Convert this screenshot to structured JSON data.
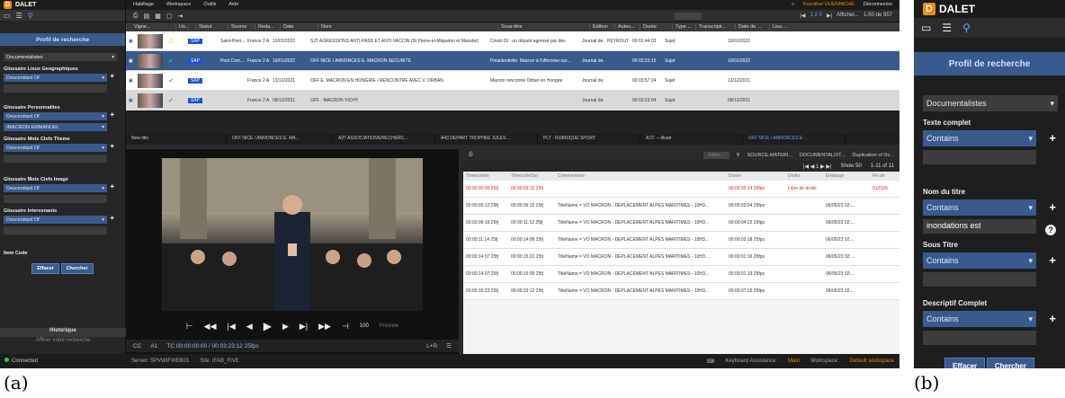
{
  "captions": {
    "a": "(a)",
    "b": "(b)"
  },
  "brand": {
    "logo_letter": "D",
    "name": "DALET"
  },
  "menu": {
    "items": [
      "Habillage",
      "Workspace",
      "Outils",
      "Aide"
    ],
    "user": "Kaouther OUENNICHE",
    "logout": "Déconnexion"
  },
  "search_panel": {
    "title": "Profil de recherche",
    "profile": "Documentalistes",
    "fields": [
      {
        "label": "Glossaire Lieux Geographiques",
        "op": "Descendant Of",
        "value": ""
      },
      {
        "label": "Glossaire Personnalites",
        "op": "Descendant Of",
        "value": "/MACRON EMMANUEL"
      },
      {
        "label": "Glossaire Mots Clefs Theme",
        "op": "Descendant Of",
        "value": ""
      },
      {
        "label": "Glossaire Mots Clefs Image",
        "op": "Descendant Of",
        "value": ""
      },
      {
        "label": "Glossaire Intervenants",
        "op": "Descendant Of",
        "value": ""
      }
    ],
    "item_code": "Item Code",
    "clear": "Effacer",
    "search": "Chercher",
    "history": "Historique",
    "refine": "Affiner votre recherche",
    "connected": "Connected"
  },
  "results": {
    "search_placeholder": "Filtre...",
    "pager": "1 2 3",
    "display": "Afficher...",
    "count": "1-50 de 957",
    "columns": [
      "Vigne...",
      "Us...",
      "Statut",
      "Source",
      "Reda...",
      "Date",
      "Nom",
      "Sous-titre",
      "Edition",
      "Auteu...",
      "Durée",
      "Type ...",
      "Transcripti...",
      "Date de ...",
      "Lieu ..."
    ],
    "rows": [
      {
        "status": "SAP",
        "source": "Saint-Pierr...",
        "reda": "France 2 A...",
        "date": "10/01/2022",
        "nom": "SJT AGRESSIONS ANTI-PASS ET ANTI-VACCIN (St Pierre-et-Miquelon et Manster)",
        "sous": "Covid-19 : un député agressé par des",
        "edition": "Journal de...",
        "auteur": "PEYROUT ...",
        "duree": "00:01:44:03",
        "type": "Sujet",
        "dated": "10/01/2022"
      },
      {
        "status": "SAP",
        "source": "Pool Com...",
        "reda": "France 2 A...",
        "date": "10/01/2022",
        "nom": "OFF NICE / ANNONCES E. MACRON SÉCURITÉ",
        "sous": "Présidentielle: Macron à l'offensive sur...",
        "edition": "Journal de...",
        "auteur": "",
        "duree": "00:03:23:15",
        "type": "Sujet",
        "dated": "10/01/2022"
      },
      {
        "status": "SAP",
        "source": "",
        "reda": "France 2 A...",
        "date": "13/12/2021",
        "nom": "OFF E. MACRON EN HONGRIE / RENCONTRE AVEC V. ORBAN",
        "sous": "Macron rencontre Orban en Hongrie",
        "edition": "Journal de...",
        "auteur": "",
        "duree": "00:03:57:24",
        "type": "Sujet",
        "dated": "13/12/2021"
      },
      {
        "status": "SAP",
        "source": "",
        "reda": "France 2 A...",
        "date": "08/12/2021",
        "nom": "OFF - MACRON VICHY",
        "sous": "",
        "edition": "Journal de...",
        "auteur": "",
        "duree": "00:03:23:04",
        "type": "Sujet",
        "dated": "08/12/2021"
      }
    ]
  },
  "tabs": [
    "New title",
    "OFF NICE / ANNONCES E. MA...",
    "A37 ASSOCIATIONS/RECHERC...",
    "A43 DEPART TROPHEE JULES ...",
    "PLT - RUBRIQUE SPORT",
    "A72 ----illustr",
    "OFF NICE / ANNONCES E. ..."
  ],
  "player": {
    "cc": "CC",
    "track": "A1",
    "timecode": "TC 00:00:00:00 / 00:03:23:12 25fps",
    "volume": "100",
    "preview": "Preview",
    "lr": "L+R"
  },
  "segments": {
    "filter": "Filtre...",
    "source": "SOURCE-MATERI...",
    "doc": "DOCUMENTALIST...",
    "dup": "Duplication of Do...",
    "show": "Show 50",
    "count": "1-11 of 11",
    "columns": [
      "TimecodeIn",
      "TimecodeOut",
      "Commentaire",
      "Durée",
      "Droits",
      "Embargo",
      "Fin de"
    ],
    "rows": [
      {
        "in": "00:00:00:00 25fj",
        "out": "00:00:03:12 25fj",
        "com": "",
        "dur": "00:00:03:14 25fps",
        "droits": "Libre de droits",
        "emb": "",
        "fin": "01/01/9"
      },
      {
        "in": "00:00:03:12 25fj",
        "out": "00:00:06:15 25fj",
        "com": "TitleName = VO MACRON - DEPLACEMENT ALPES MARITIMES - 10H3...",
        "dur": "00:00:03:04 25fps",
        "droits": "",
        "emb": "06/05/23 02:...",
        "fin": ""
      },
      {
        "in": "00:00:06:16 25fj",
        "out": "00:00:11:12 25fj",
        "com": "TitleName = VO MACRON - DEPLACEMENT ALPES MARITIMES - 10H3...",
        "dur": "00:00:04:22 25fps",
        "droits": "",
        "emb": "06/05/23 02:...",
        "fin": ""
      },
      {
        "in": "00:00:11:14 25fj",
        "out": "00:00:14:06 25fj",
        "com": "TitleName = VO MACRON - DEPLACEMENT ALPES MARITIMES - 10H3...",
        "dur": "00:00:02:18 25fps",
        "droits": "",
        "emb": "06/05/23 02:...",
        "fin": ""
      },
      {
        "in": "00:00:14:07 25fj",
        "out": "00:00:15:22 25fj",
        "com": "TitleName = VO MACRON - DEPLACEMENT ALPES MARITIMES - 10H3...",
        "dur": "00:00:01:16 25fps",
        "droits": "",
        "emb": "06/05/23 02:...",
        "fin": ""
      },
      {
        "in": "00:00:14:07 25fj",
        "out": "00:00:16:00 25fj",
        "com": "TitleName = VO MACRON - DEPLACEMENT ALPES MARITIMES - 10H3...",
        "dur": "00:00:01:19 25fps",
        "droits": "",
        "emb": "06/05/23 02:...",
        "fin": ""
      },
      {
        "in": "00:00:15:23 25fj",
        "out": "00:00:23:12 25fj",
        "com": "TitleName = VO MACRON - DEPLACEMENT ALPES MARITIMES - 10H3...",
        "dur": "00:00:07:15 25fps",
        "droits": "",
        "emb": "06/05/23 02:...",
        "fin": ""
      }
    ]
  },
  "statusbar": {
    "server": "Server: SPVWIFWEB01",
    "site": "Site: IFAB_FIVE",
    "kb": "Keyboard Assistance:",
    "kb_val": "Main",
    "ws": "Workspace:",
    "ws_val": "Default workspace"
  },
  "panel_b": {
    "title": "Profil de recherche",
    "profile": "Documentalistes",
    "fields": [
      {
        "label": "Texte complet",
        "op": "Contains",
        "value": ""
      },
      {
        "label": "Nom du titre",
        "op": "Contains",
        "value": "inondations est"
      },
      {
        "label": "Sous Titre",
        "op": "Contains",
        "value": ""
      },
      {
        "label": "Descriptif Complet",
        "op": "Contains",
        "value": ""
      }
    ],
    "clear": "Effacer",
    "search": "Chercher",
    "help": "?"
  }
}
